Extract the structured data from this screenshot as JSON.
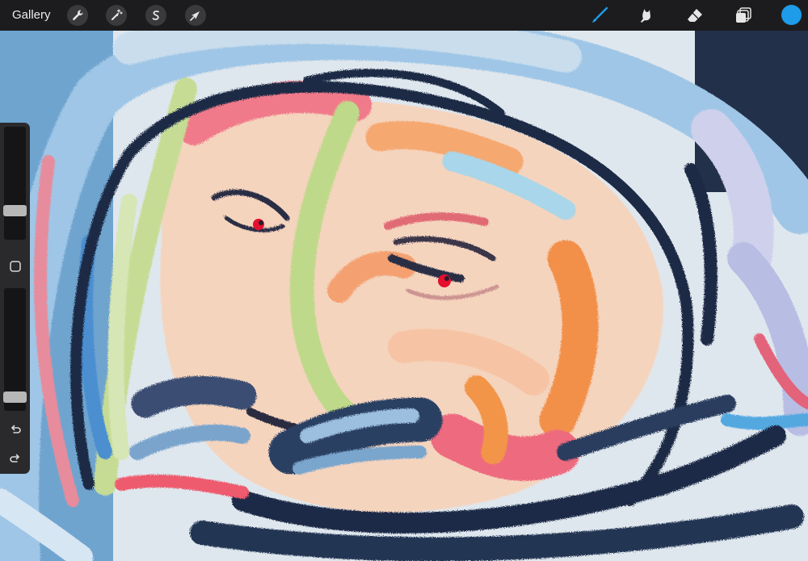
{
  "toolbar": {
    "gallery_label": "Gallery",
    "actions_icon": "wrench-icon",
    "adjustments_icon": "magic-wand-icon",
    "selection_icon": "selection-s-icon",
    "transform_icon": "arrow-cursor-icon",
    "brush_icon": "brush-icon",
    "smudge_icon": "smudge-icon",
    "eraser_icon": "eraser-icon",
    "layers_icon": "layers-icon",
    "active_tool": "brush",
    "accent_color": "#1e9be9",
    "current_color": "#1e9be9"
  },
  "sidebar": {
    "brush_size_level": 0.23,
    "opacity_level": 0.07,
    "modify_button_icon": "square-icon",
    "undo_icon": "undo-icon",
    "redo_icon": "redo-icon"
  }
}
